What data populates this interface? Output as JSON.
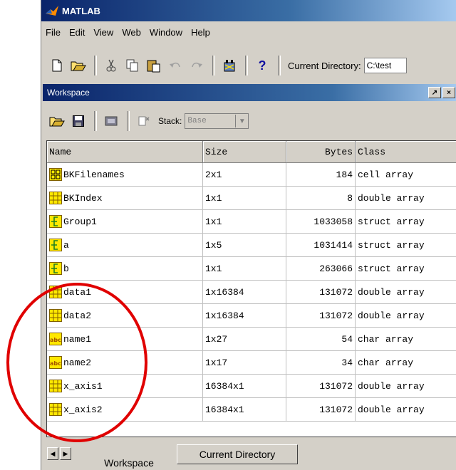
{
  "app": {
    "title": "MATLAB"
  },
  "menu": [
    "File",
    "Edit",
    "View",
    "Web",
    "Window",
    "Help"
  ],
  "toolbar": {
    "icons": [
      "new-file-icon",
      "open-folder-icon",
      "cut-icon",
      "copy-icon",
      "paste-icon",
      "undo-icon",
      "redo-icon",
      "simulink-icon",
      "help-icon"
    ],
    "help_glyph": "?",
    "current_dir_label": "Current Directory:",
    "current_dir_value": "C:\\test"
  },
  "workspace": {
    "title": "Workspace",
    "undock_glyph": "↗",
    "close_glyph": "×",
    "stack_label": "Stack:",
    "stack_value": "Base",
    "columns": [
      "Name",
      "Size",
      "Bytes",
      "Class"
    ],
    "rows": [
      {
        "icon": "cell",
        "name": "BKFilenames",
        "size": "2x1",
        "bytes": "184",
        "class": "cell array"
      },
      {
        "icon": "double",
        "name": "BKIndex",
        "size": "1x1",
        "bytes": "8",
        "class": "double array"
      },
      {
        "icon": "struct",
        "name": "Group1",
        "size": "1x1",
        "bytes": "1033058",
        "class": "struct array"
      },
      {
        "icon": "struct",
        "name": "a",
        "size": "1x5",
        "bytes": "1031414",
        "class": "struct array"
      },
      {
        "icon": "struct",
        "name": "b",
        "size": "1x1",
        "bytes": "263066",
        "class": "struct array"
      },
      {
        "icon": "double",
        "name": "data1",
        "size": "1x16384",
        "bytes": "131072",
        "class": "double array"
      },
      {
        "icon": "double",
        "name": "data2",
        "size": "1x16384",
        "bytes": "131072",
        "class": "double array"
      },
      {
        "icon": "char",
        "name": "name1",
        "size": "1x27",
        "bytes": "54",
        "class": "char array"
      },
      {
        "icon": "char",
        "name": "name2",
        "size": "1x17",
        "bytes": "34",
        "class": "char array"
      },
      {
        "icon": "double",
        "name": "x_axis1",
        "size": "16384x1",
        "bytes": "131072",
        "class": "double array"
      },
      {
        "icon": "double",
        "name": "x_axis2",
        "size": "16384x1",
        "bytes": "131072",
        "class": "double array"
      }
    ]
  },
  "tabs": [
    "Workspace",
    "Current Directory"
  ],
  "colors": {
    "annotation": "#e00000",
    "titlebar": "#0a246a",
    "icon_yellow": "#ffe800"
  }
}
